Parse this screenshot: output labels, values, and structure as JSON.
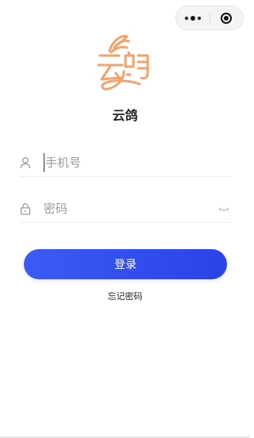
{
  "app": {
    "name": "云鸽"
  },
  "logo": {
    "text": "云鸽",
    "color": "#f2a26c"
  },
  "form": {
    "phone_placeholder": "手机号",
    "password_placeholder": "密码",
    "login_label": "登录",
    "forgot_label": "忘记密码"
  },
  "theme": {
    "accent": "#2f4cf0",
    "icon_color": "#9a9a9a"
  }
}
